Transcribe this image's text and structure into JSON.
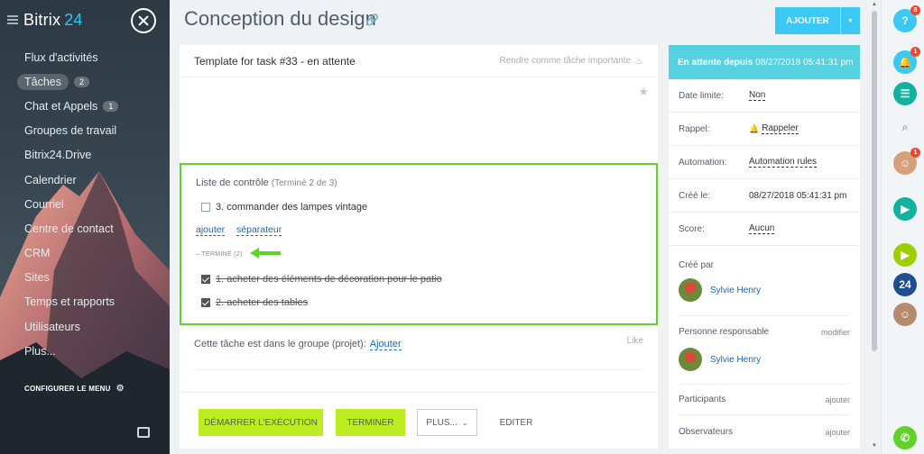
{
  "sidebar": {
    "logo": "Bitrix",
    "logo_num": "24",
    "items": [
      {
        "label": "Flux d'activités",
        "count": ""
      },
      {
        "label": "Tâches",
        "count": "2"
      },
      {
        "label": "Chat et Appels",
        "count": "1"
      },
      {
        "label": "Groupes de travail",
        "count": ""
      },
      {
        "label": "Bitrix24.Drive",
        "count": ""
      },
      {
        "label": "Calendrier",
        "count": ""
      },
      {
        "label": "Courriel",
        "count": ""
      },
      {
        "label": "Centre de contact",
        "count": ""
      },
      {
        "label": "CRM",
        "count": ""
      },
      {
        "label": "Sites",
        "count": ""
      },
      {
        "label": "Temps et rapports",
        "count": ""
      },
      {
        "label": "Utilisateurs",
        "count": ""
      },
      {
        "label": "Plus...",
        "count": ""
      }
    ],
    "config_label": "CONFIGURER LE MENU"
  },
  "header": {
    "title": "Conception du design",
    "add_label": "AJOUTER"
  },
  "task": {
    "title": "Template for task #33 - en attente",
    "important_label": "Rendre comme tâche importante",
    "checklist": {
      "title": "Liste de contrôle",
      "progress": "(Terminé 2 de 3)",
      "open_items": [
        {
          "text": "3. commander des lampes vintage",
          "checked": false
        }
      ],
      "add_link": "ajouter",
      "separator_link": "séparateur",
      "done_toggle": "TERMINÉ (2)",
      "done_items": [
        {
          "text": "1. acheter des éléments de décoration pour le patio",
          "checked": true
        },
        {
          "text": "2. acheter des tables",
          "checked": true
        }
      ]
    },
    "group_label": "Cette tâche est dans le groupe (projet):",
    "group_link": "Ajouter",
    "like_label": "Like",
    "buttons": {
      "start": "DÉMARRER L'EXÉCUTION",
      "finish": "TERMINER",
      "more": "PLUS...",
      "edit": "EDITER"
    }
  },
  "info": {
    "status": "En attente depuis",
    "status_date": "08/27/2018 05:41:31 pm",
    "rows": [
      {
        "key": "Date limite:",
        "value": "Non"
      },
      {
        "key": "Rappel:",
        "value": "Rappeler"
      },
      {
        "key": "Automation:",
        "value": "Automation rules"
      },
      {
        "key": "Créé le:",
        "value": "08/27/2018 05:41:31 pm"
      },
      {
        "key": "Score:",
        "value": "Aucun"
      }
    ],
    "created_by_label": "Créé par",
    "created_by": "Sylvie Henry",
    "responsible_label": "Personne responsable",
    "responsible_action": "modifier",
    "responsible": "Sylvie Henry",
    "participants_label": "Participants",
    "participants_action": "ajouter",
    "observers_label": "Observateurs",
    "observers_action": "ajouter"
  },
  "rail": {
    "help_badge": "8",
    "notif_badge": "1",
    "avatar_badge": "1",
    "b24_label": "24"
  },
  "colors": {
    "accent": "#3bc8f5",
    "status_header": "#56d1e0",
    "primary_button": "#bbed21",
    "highlight_border": "#62d129",
    "link": "#2067b0"
  }
}
